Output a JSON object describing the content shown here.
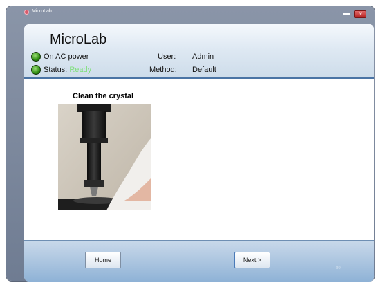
{
  "window": {
    "title": "MicroLab",
    "close_glyph": "×"
  },
  "header": {
    "app_title": "MicroLab",
    "power_label": "On AC power",
    "status_label": "Status:",
    "status_value": "Ready",
    "user_label": "User:",
    "user_value": "Admin",
    "method_label": "Method:",
    "method_value": "Default",
    "indicator_color": "#3a9a1a"
  },
  "content": {
    "caption": "Clean the crystal",
    "image_icon": "instrument-photo"
  },
  "footer": {
    "home_label": "Home",
    "next_label": "Next >",
    "watermark": "80"
  }
}
